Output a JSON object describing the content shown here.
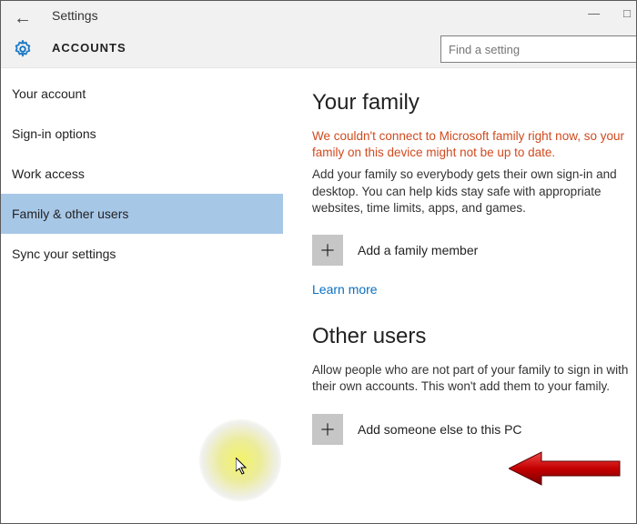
{
  "header": {
    "title": "Settings",
    "subtitle": "ACCOUNTS",
    "search_placeholder": "Find a setting"
  },
  "sidebar": {
    "items": [
      {
        "label": "Your account",
        "selected": false
      },
      {
        "label": "Sign-in options",
        "selected": false
      },
      {
        "label": "Work access",
        "selected": false
      },
      {
        "label": "Family & other users",
        "selected": true
      },
      {
        "label": "Sync your settings",
        "selected": false
      }
    ]
  },
  "main": {
    "family": {
      "heading": "Your family",
      "error": "We couldn't connect to Microsoft family right now, so your family on this device might not be up to date.",
      "description": "Add your family so everybody gets their own sign-in and desktop. You can help kids stay safe with appropriate websites, time limits, apps, and games.",
      "add_label": "Add a family member",
      "learn_more": "Learn more"
    },
    "other": {
      "heading": "Other users",
      "description": "Allow people who are not part of your family to sign in with their own accounts. This won't add them to your family.",
      "add_label": "Add someone else to this PC"
    }
  }
}
